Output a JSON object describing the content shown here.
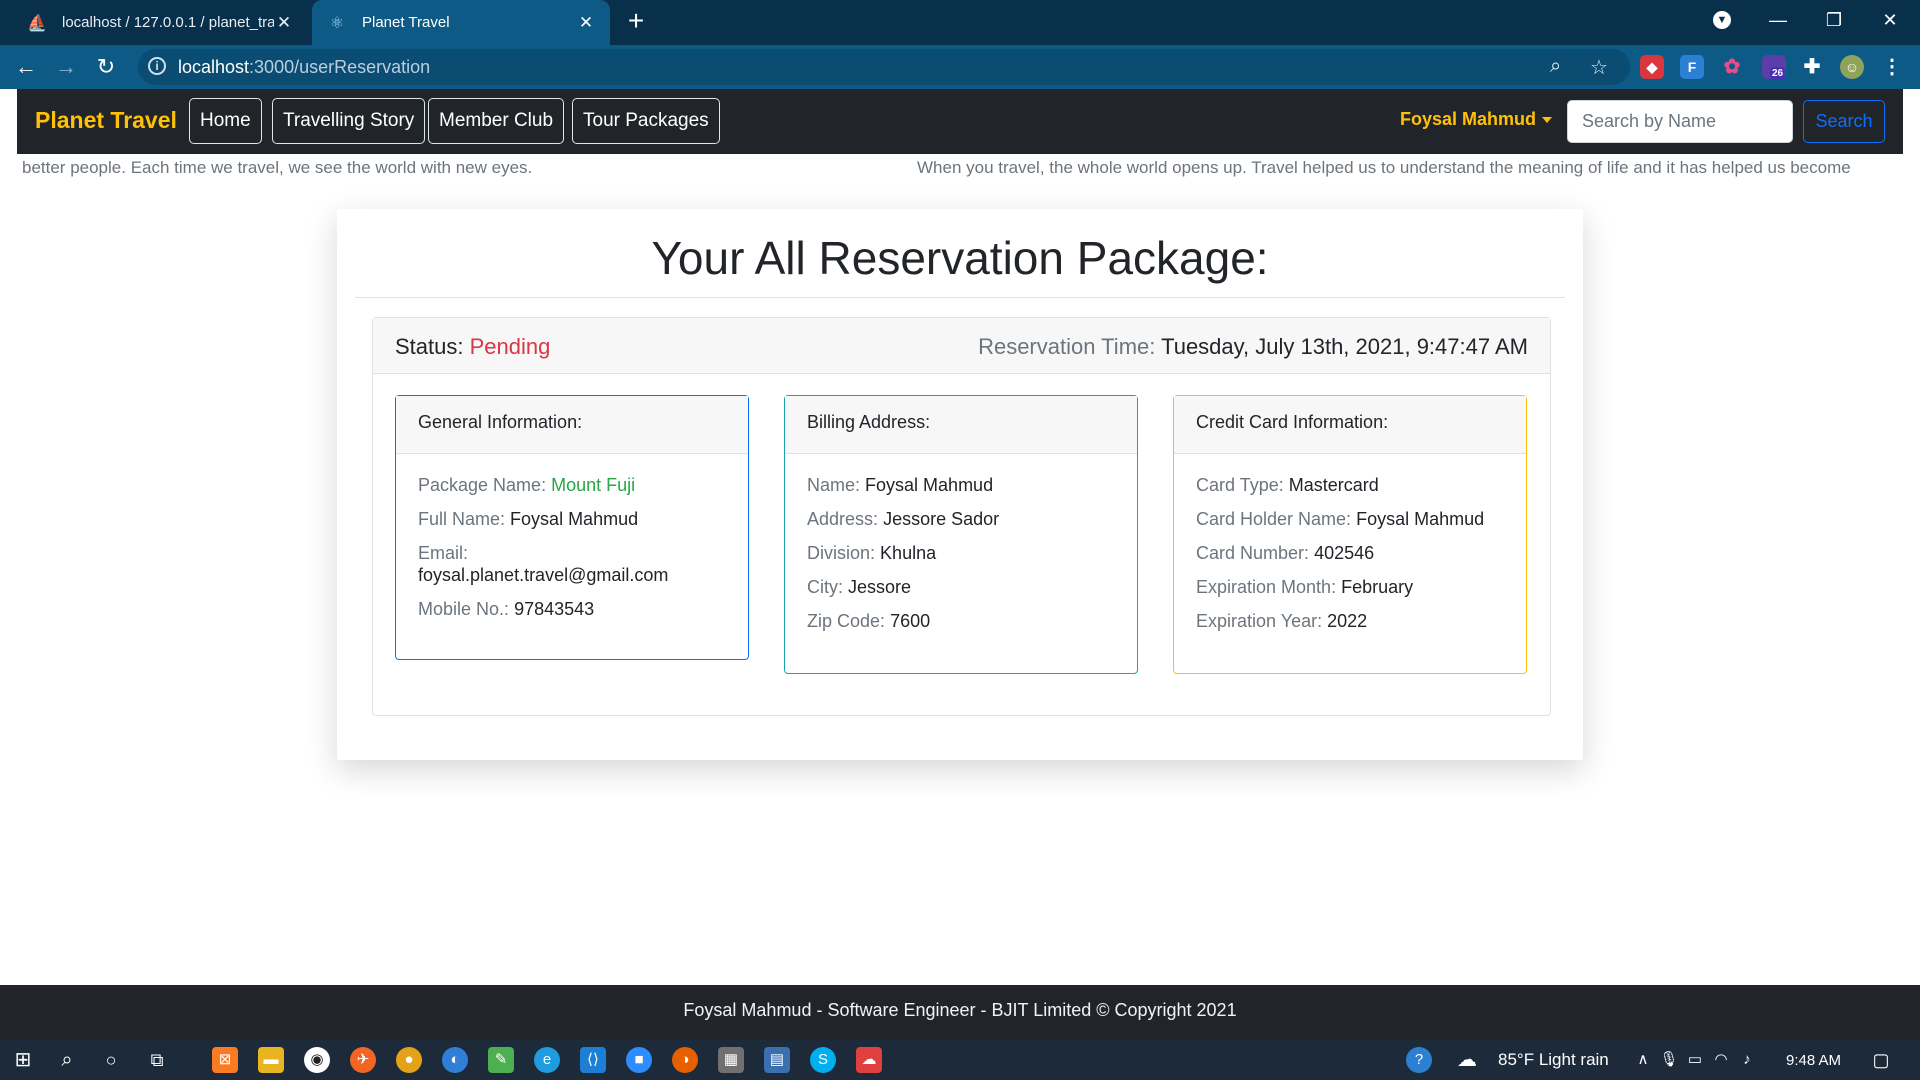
{
  "browser": {
    "tabs": [
      {
        "label": "localhost / 127.0.0.1 / planet_tra",
        "favicon": "phpmyadmin-icon"
      },
      {
        "label": "Planet Travel",
        "favicon": "react-icon"
      }
    ],
    "url_host": "localhost",
    "url_path": ":3000/userReservation"
  },
  "navbar": {
    "brand": "Planet Travel",
    "links": [
      "Home",
      "Travelling Story",
      "Member Club",
      "Tour Packages"
    ],
    "user": "Foysal Mahmud",
    "search_placeholder": "Search by Name",
    "search_button": "Search"
  },
  "marquee": {
    "left": "better people. Each time we travel, we see the world with new eyes.",
    "right": "When you travel, the whole world opens up. Travel helped us to understand the meaning of life and it has helped us become"
  },
  "page": {
    "title": "Your All Reservation Package:",
    "status_label": "Status:",
    "status_value": "Pending",
    "time_label": "Reservation Time:",
    "time_value": "Tuesday, July 13th, 2021, 9:47:47 AM"
  },
  "general": {
    "header": "General Information:",
    "package_label": "Package Name:",
    "package_value": "Mount Fuji",
    "fullname_label": "Full Name:",
    "fullname_value": "Foysal Mahmud",
    "email_label": "Email:",
    "email_value": "foysal.planet.travel@gmail.com",
    "mobile_label": "Mobile No.:",
    "mobile_value": "97843543"
  },
  "billing": {
    "header": "Billing Address:",
    "name_label": "Name:",
    "name_value": "Foysal Mahmud",
    "address_label": "Address:",
    "address_value": "Jessore Sador",
    "division_label": "Division:",
    "division_value": "Khulna",
    "city_label": "City:",
    "city_value": "Jessore",
    "zip_label": "Zip Code:",
    "zip_value": "7600"
  },
  "card": {
    "header": "Credit Card Information:",
    "type_label": "Card Type:",
    "type_value": "Mastercard",
    "holder_label": "Card Holder Name:",
    "holder_value": "Foysal Mahmud",
    "number_label": "Card Number:",
    "number_value": "402546",
    "month_label": "Expiration Month:",
    "month_value": "February",
    "year_label": "Expiration Year:",
    "year_value": "2022"
  },
  "footer": "Foysal Mahmud - Software Engineer - BJIT Limited © Copyright 2021",
  "taskbar": {
    "weather": "85°F  Light rain",
    "clock": "9:48 AM",
    "extension_badge": "26"
  },
  "colors": {
    "brand": "#ffc107",
    "status_pending": "#dc3545",
    "package_name": "#28a745",
    "general_border": "#0d6efd",
    "billing_border": "#17a2b8",
    "card_border": "#ffc107"
  }
}
